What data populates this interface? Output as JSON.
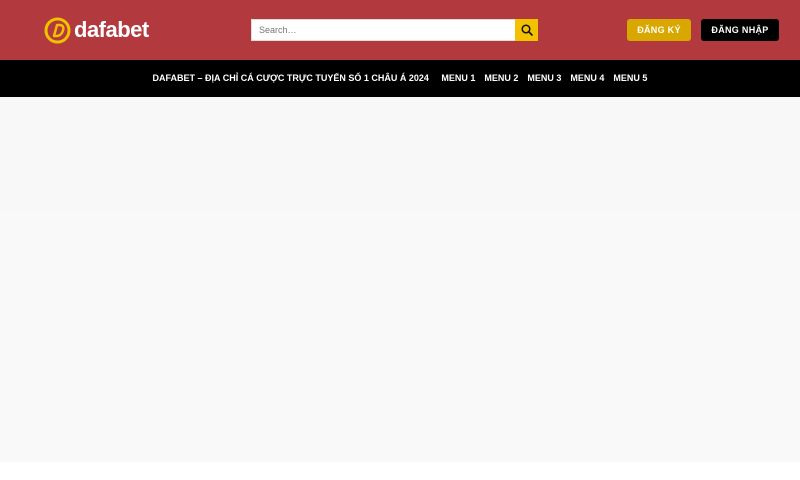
{
  "header": {
    "logo_text": "dafabet",
    "search": {
      "placeholder": "Search…",
      "value": ""
    },
    "register_label": "ĐĂNG KÝ",
    "login_label": "ĐĂNG NHẬP",
    "colors": {
      "header_bg": "#b23a3e",
      "accent": "#f2c100",
      "register_bg": "#d9a800"
    }
  },
  "nav": {
    "items": [
      {
        "label": "DAFABET – ĐỊA CHỈ CÁ CƯỢC TRỰC TUYẾN SỐ 1 CHÂU Á 2024"
      },
      {
        "label": "MENU 1"
      },
      {
        "label": "MENU 2"
      },
      {
        "label": "MENU 3"
      },
      {
        "label": "MENU 4"
      },
      {
        "label": "MENU 5"
      }
    ]
  },
  "icons": {
    "search": "search-icon",
    "logo": "dafabet-logo-icon"
  }
}
